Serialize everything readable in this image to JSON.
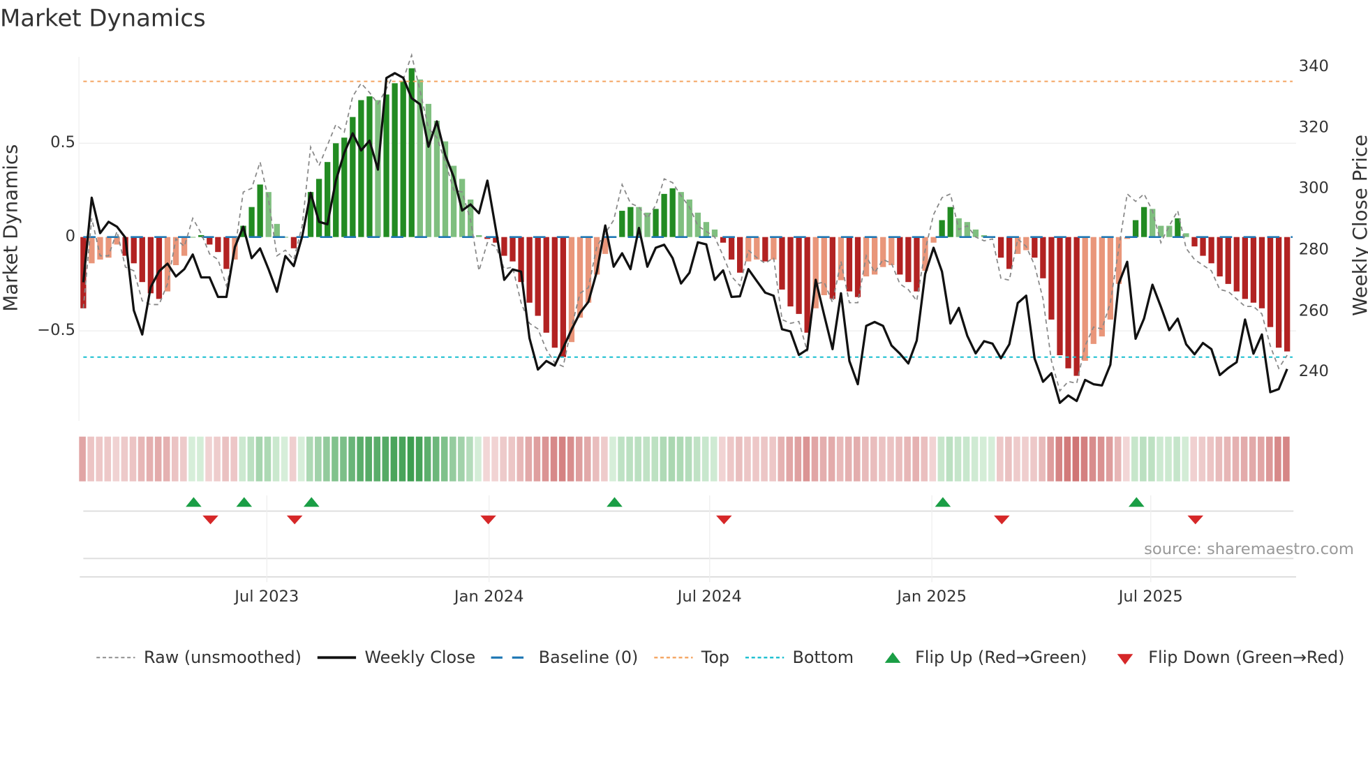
{
  "title": "Market Dynamics",
  "source": "source: sharemaestro.com",
  "colors": {
    "green_strong": "#228b22",
    "green_weak": "#7fbf7f",
    "red_strong": "#b22222",
    "red_weak": "#e9967a",
    "raw": "#888888",
    "close": "#111111",
    "baseline": "#1f77b4",
    "top": "#f4a460",
    "bottom": "#17becf",
    "flip_up": "#1a9e45",
    "flip_down": "#d62728"
  },
  "chart_data": {
    "type": "bar",
    "title": "Market Dynamics",
    "ylabel": "Market Dynamics",
    "ylabel_right": "Weekly Close Price",
    "ylim": [
      -0.98,
      0.96
    ],
    "ylim_right": [
      224,
      343.2
    ],
    "yticks": [
      {
        "v": 0.5,
        "label": "0.5"
      },
      {
        "v": 0,
        "label": "0"
      },
      {
        "v": -0.5,
        "label": "−0.5"
      }
    ],
    "yticks_right": [
      {
        "v": 340,
        "label": "340"
      },
      {
        "v": 320,
        "label": "320"
      },
      {
        "v": 300,
        "label": "300"
      },
      {
        "v": 280,
        "label": "280"
      },
      {
        "v": 260,
        "label": "260"
      },
      {
        "v": 240,
        "label": "240"
      }
    ],
    "xticks": [
      {
        "week": 21.8,
        "label": "Jul 2023"
      },
      {
        "week": 48.2,
        "label": "Jan 2024"
      },
      {
        "week": 74.4,
        "label": "Jul 2024"
      },
      {
        "week": 100.8,
        "label": "Jan 2025"
      },
      {
        "week": 126.8,
        "label": "Jul 2025"
      }
    ],
    "top_level": 0.83,
    "bottom_level": -0.64,
    "baseline": 0,
    "momentum": [
      -0.38,
      -0.14,
      -0.12,
      -0.11,
      -0.04,
      -0.1,
      -0.14,
      -0.24,
      -0.3,
      -0.33,
      -0.29,
      -0.15,
      -0.1,
      0.0,
      0.01,
      -0.04,
      -0.08,
      -0.17,
      -0.12,
      0.06,
      0.16,
      0.28,
      0.24,
      0.07,
      0.0,
      -0.06,
      0.0,
      0.24,
      0.31,
      0.4,
      0.5,
      0.53,
      0.64,
      0.73,
      0.75,
      0.73,
      0.76,
      0.82,
      0.83,
      0.9,
      0.84,
      0.71,
      0.62,
      0.51,
      0.38,
      0.31,
      0.2,
      0.01,
      -0.01,
      -0.03,
      -0.1,
      -0.13,
      -0.24,
      -0.35,
      -0.42,
      -0.51,
      -0.59,
      -0.64,
      -0.56,
      -0.43,
      -0.35,
      -0.2,
      -0.09,
      0.0,
      0.14,
      0.16,
      0.16,
      0.13,
      0.15,
      0.23,
      0.26,
      0.24,
      0.2,
      0.13,
      0.08,
      0.04,
      -0.03,
      -0.12,
      -0.19,
      -0.13,
      -0.12,
      -0.13,
      -0.12,
      -0.28,
      -0.37,
      -0.41,
      -0.51,
      -0.38,
      -0.31,
      -0.33,
      -0.23,
      -0.29,
      -0.32,
      -0.21,
      -0.2,
      -0.16,
      -0.15,
      -0.2,
      -0.24,
      -0.29,
      -0.18,
      -0.03,
      0.09,
      0.16,
      0.1,
      0.08,
      0.04,
      0.01,
      0.0,
      -0.11,
      -0.17,
      -0.09,
      -0.07,
      -0.11,
      -0.22,
      -0.44,
      -0.63,
      -0.7,
      -0.74,
      -0.66,
      -0.57,
      -0.53,
      -0.44,
      -0.25,
      -0.01,
      0.09,
      0.16,
      0.15,
      0.06,
      0.06,
      0.1,
      0.02,
      -0.05,
      -0.1,
      -0.14,
      -0.21,
      -0.25,
      -0.29,
      -0.33,
      -0.35,
      -0.38,
      -0.48,
      -0.59,
      -0.61
    ],
    "raw": [
      -0.38,
      0.1,
      -0.1,
      -0.1,
      0.03,
      -0.16,
      -0.18,
      -0.34,
      -0.36,
      -0.36,
      -0.25,
      -0.01,
      -0.05,
      0.1,
      0.02,
      -0.09,
      -0.12,
      -0.26,
      -0.07,
      0.24,
      0.26,
      0.4,
      0.2,
      -0.1,
      -0.07,
      -0.12,
      0.06,
      0.48,
      0.38,
      0.49,
      0.6,
      0.56,
      0.75,
      0.82,
      0.77,
      0.71,
      0.79,
      0.88,
      0.84,
      0.97,
      0.78,
      0.58,
      0.53,
      0.4,
      0.25,
      0.24,
      0.09,
      -0.18,
      -0.03,
      -0.05,
      -0.17,
      -0.16,
      -0.35,
      -0.46,
      -0.49,
      -0.6,
      -0.67,
      -0.69,
      -0.48,
      -0.3,
      -0.27,
      -0.05,
      0.02,
      0.09,
      0.28,
      0.18,
      0.16,
      0.1,
      0.17,
      0.31,
      0.29,
      0.22,
      0.16,
      0.06,
      0.03,
      0.0,
      -0.1,
      -0.21,
      -0.26,
      -0.07,
      -0.11,
      -0.14,
      -0.11,
      -0.44,
      -0.46,
      -0.45,
      -0.61,
      -0.25,
      -0.24,
      -0.35,
      -0.13,
      -0.35,
      -0.35,
      -0.1,
      -0.19,
      -0.12,
      -0.14,
      -0.25,
      -0.28,
      -0.34,
      -0.07,
      0.12,
      0.21,
      0.23,
      0.04,
      0.06,
      0.0,
      -0.02,
      -0.01,
      -0.22,
      -0.23,
      -0.01,
      -0.05,
      -0.15,
      -0.33,
      -0.66,
      -0.82,
      -0.77,
      -0.78,
      -0.58,
      -0.48,
      -0.49,
      -0.35,
      -0.06,
      0.23,
      0.19,
      0.23,
      0.14,
      -0.03,
      0.06,
      0.14,
      -0.06,
      -0.12,
      -0.15,
      -0.18,
      -0.28,
      -0.29,
      -0.33,
      -0.37,
      -0.37,
      -0.41,
      -0.58,
      -0.7,
      -0.63
    ],
    "weekly_close": [
      269.4,
      297.1,
      285.5,
      289.2,
      287.6,
      284.0,
      260.2,
      252.3,
      267.8,
      273.0,
      275.5,
      271.3,
      273.7,
      278.5,
      271.0,
      271.0,
      264.6,
      264.6,
      280.9,
      287.6,
      277.3,
      280.5,
      273.7,
      266.3,
      278.0,
      274.7,
      284.4,
      298.7,
      289.2,
      288.4,
      302.7,
      311.8,
      318.2,
      312.6,
      315.8,
      306.3,
      336.3,
      337.9,
      336.4,
      329.7,
      327.7,
      313.8,
      322.1,
      311.0,
      303.9,
      292.9,
      294.9,
      292.0,
      302.7,
      286.8,
      270.2,
      273.6,
      272.9,
      251.1,
      240.8,
      243.6,
      242.1,
      247.9,
      253.9,
      259.4,
      263.0,
      272.9,
      288.0,
      274.5,
      278.9,
      273.7,
      287.2,
      274.5,
      280.7,
      281.7,
      277.3,
      269.0,
      272.5,
      282.5,
      281.8,
      270.2,
      273.3,
      264.6,
      264.8,
      273.7,
      269.8,
      266.0,
      265.0,
      254.0,
      253.3,
      245.6,
      247.4,
      270.2,
      258.7,
      247.5,
      265.8,
      243.6,
      236.0,
      255.1,
      256.4,
      255.1,
      248.7,
      246.0,
      242.8,
      250.3,
      272.1,
      280.7,
      272.9,
      255.9,
      261.0,
      251.9,
      246.1,
      250.1,
      249.3,
      244.5,
      249.1,
      262.6,
      265.0,
      244.4,
      236.8,
      239.6,
      229.9,
      232.3,
      230.5,
      237.4,
      236.0,
      235.6,
      242.4,
      269.0,
      276.1,
      250.9,
      257.5,
      268.6,
      261.4,
      253.7,
      257.5,
      249.1,
      245.8,
      249.5,
      247.5,
      239.0,
      241.3,
      243.2,
      257.2,
      246.0,
      252.3,
      233.4,
      234.4,
      241.0
    ],
    "flip_up_weeks": [
      13,
      19,
      27,
      63,
      102,
      125
    ],
    "flip_down_weeks": [
      15,
      25,
      48,
      76,
      109,
      132
    ],
    "legend": [
      {
        "key": "raw",
        "label": "Raw (unsmoothed)"
      },
      {
        "key": "close",
        "label": "Weekly Close"
      },
      {
        "key": "baseline",
        "label": "Baseline (0)"
      },
      {
        "key": "top",
        "label": "Top"
      },
      {
        "key": "bottom",
        "label": "Bottom"
      },
      {
        "key": "flip_up",
        "label": "Flip Up (Red→Green)"
      },
      {
        "key": "flip_down",
        "label": "Flip Down (Green→Red)"
      }
    ],
    "legend_position": "bottom"
  }
}
